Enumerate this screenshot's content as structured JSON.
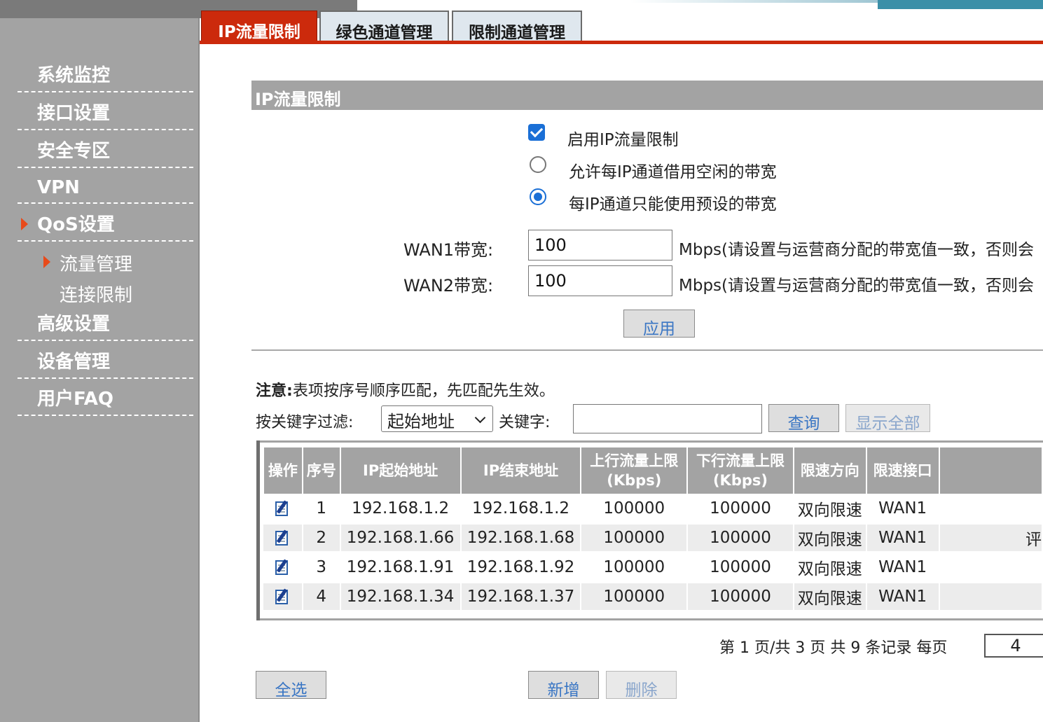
{
  "sidebar": {
    "items": [
      {
        "label": "系统监控"
      },
      {
        "label": "接口设置"
      },
      {
        "label": "安全专区"
      },
      {
        "label": "VPN"
      },
      {
        "label": "QoS设置"
      },
      {
        "label": "高级设置"
      },
      {
        "label": "设备管理"
      },
      {
        "label": "用户FAQ"
      }
    ],
    "sub_items": [
      {
        "label": "流量管理"
      },
      {
        "label": "连接限制"
      }
    ]
  },
  "tabs": [
    {
      "label": "IP流量限制",
      "active": true
    },
    {
      "label": "绿色通道管理"
    },
    {
      "label": "限制通道管理"
    }
  ],
  "section": {
    "title": "IP流量限制"
  },
  "options": {
    "enable_label": "启用IP流量限制",
    "enable_checked": true,
    "borrow_label": "允许每IP通道借用空闲的带宽",
    "preset_label": "每IP通道只能使用预设的带宽",
    "selected_mode": "preset"
  },
  "bandwidth": {
    "wan1_label": "WAN1带宽:",
    "wan1_value": "100",
    "wan2_label": "WAN2带宽:",
    "wan2_value": "100",
    "note": "Mbps(请设置与运营商分配的带宽值一致，否则会"
  },
  "buttons": {
    "apply": "应用",
    "query": "查询",
    "show_all": "显示全部",
    "select_all": "全选",
    "add": "新增",
    "delete": "删除"
  },
  "notice": {
    "bold": "注意:",
    "text": "表项按序号顺序匹配，先匹配先生效。"
  },
  "filter": {
    "label": "按关键字过滤:",
    "selected": "起始地址",
    "keyword_label": "关键字:",
    "keyword_value": ""
  },
  "table": {
    "headers": [
      "操作",
      "序号",
      "IP起始地址",
      "IP结束地址",
      "上行流量上限\n(Kbps)",
      "下行流量上限\n(Kbps)",
      "限速方向",
      "限速接口",
      ""
    ],
    "rows": [
      {
        "seq": "1",
        "start": "192.168.1.2",
        "end": "192.168.1.2",
        "up": "100000",
        "down": "100000",
        "dir": "双向限速",
        "iface": "WAN1",
        "extra": ""
      },
      {
        "seq": "2",
        "start": "192.168.1.66",
        "end": "192.168.1.68",
        "up": "100000",
        "down": "100000",
        "dir": "双向限速",
        "iface": "WAN1",
        "extra": "评"
      },
      {
        "seq": "3",
        "start": "192.168.1.91",
        "end": "192.168.1.92",
        "up": "100000",
        "down": "100000",
        "dir": "双向限速",
        "iface": "WAN1",
        "extra": ""
      },
      {
        "seq": "4",
        "start": "192.168.1.34",
        "end": "192.168.1.37",
        "up": "100000",
        "down": "100000",
        "dir": "双向限速",
        "iface": "WAN1",
        "extra": ""
      }
    ]
  },
  "pager": {
    "text": "第 1 页/共 3 页 共 9 条记录 每页",
    "per_page": "4"
  },
  "colors": {
    "accent": "#cc2a0c",
    "sidebar_bg": "#a3a3a3",
    "link_blue": "#3a76c4",
    "check_blue": "#1a6fd6"
  }
}
